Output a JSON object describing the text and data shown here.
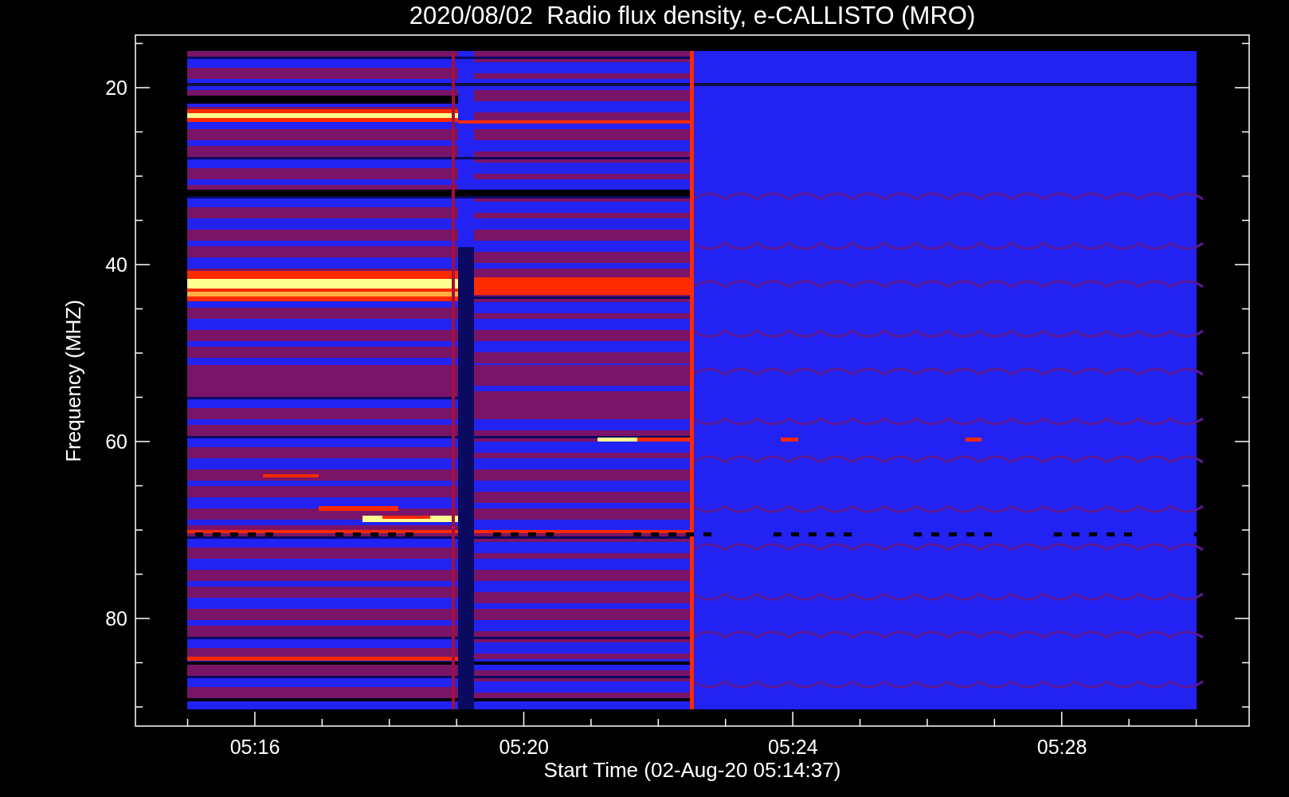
{
  "title": "2020/08/02  Radio flux density, e-CALLISTO (MRO)",
  "y_axis": {
    "label": "Frequency (MHZ)",
    "ticks": [
      "20",
      "40",
      "60",
      "80"
    ]
  },
  "x_axis": {
    "label": "Start Time (02-Aug-20 05:14:37)",
    "ticks": [
      "05:16",
      "05:20",
      "05:24",
      "05:28"
    ]
  }
}
